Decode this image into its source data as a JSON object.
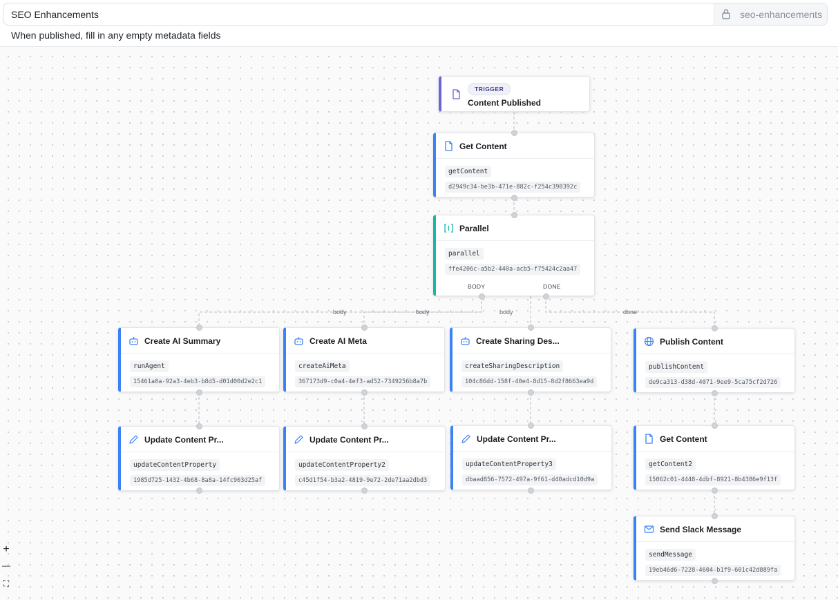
{
  "header": {
    "workflow_name": "SEO Enhancements",
    "slug": "seo-enhancements",
    "description": "When published, fill in any empty metadata fields"
  },
  "trigger": {
    "badge": "TRIGGER",
    "title": "Content Published",
    "icon": "document-icon"
  },
  "nodes": {
    "get_content": {
      "title": "Get Content",
      "key": "getContent",
      "id": "d2949c34-be3b-471e-882c-f254c398392c",
      "icon": "document-icon"
    },
    "parallel": {
      "title": "Parallel",
      "key": "parallel",
      "id": "ffe4206c-a5b2-440a-acb5-f75424c2aa47",
      "icon": "brackets-icon",
      "out_body": "BODY",
      "out_done": "DONE"
    },
    "create_ai_summary": {
      "title": "Create AI Summary",
      "key": "runAgent",
      "id": "15461a0a-92a3-4eb3-b8d5-d01d00d2e2c1",
      "icon": "robot-icon"
    },
    "create_ai_meta": {
      "title": "Create AI Meta",
      "key": "createAiMeta",
      "id": "367173d9-c0a4-4ef3-ad52-7349256b8a7b",
      "icon": "robot-icon"
    },
    "create_sharing_desc": {
      "title": "Create Sharing Des...",
      "key": "createSharingDescription",
      "id": "104c86dd-158f-40e4-8d15-8d2f8663ea9d",
      "icon": "robot-icon"
    },
    "publish_content": {
      "title": "Publish Content",
      "key": "publishContent",
      "id": "de9ca313-d38d-4071-9ee9-5ca75cf2d726",
      "icon": "globe-icon"
    },
    "update_1": {
      "title": "Update Content Pr...",
      "key": "updateContentProperty",
      "id": "1985d725-1432-4b68-8a8a-14fc903d25af",
      "icon": "pencil-icon"
    },
    "update_2": {
      "title": "Update Content Pr...",
      "key": "updateContentProperty2",
      "id": "c45d1f54-b3a2-4819-9e72-2de71aa2dbd3",
      "icon": "pencil-icon"
    },
    "update_3": {
      "title": "Update Content Pr...",
      "key": "updateContentProperty3",
      "id": "dbaad856-7572-497a-9f61-d40adcd10d9a",
      "icon": "pencil-icon"
    },
    "get_content_2": {
      "title": "Get Content",
      "key": "getContent2",
      "id": "15062c01-4448-4dbf-8921-8b4386e9f13f",
      "icon": "document-icon"
    },
    "send_slack": {
      "title": "Send Slack Message",
      "key": "sendMessage",
      "id": "19eb46d6-7228-4604-b1f9-601c42d889fa",
      "icon": "mail-icon"
    }
  },
  "edge_labels": {
    "body": "body",
    "done": "done"
  },
  "controls": {
    "zoom_in": "+",
    "zoom_out": "—",
    "fit": "⛶"
  },
  "colors": {
    "action_accent": "#3b82f6",
    "trigger_accent": "#6b63d6",
    "parallel_accent": "#14b8a6"
  }
}
